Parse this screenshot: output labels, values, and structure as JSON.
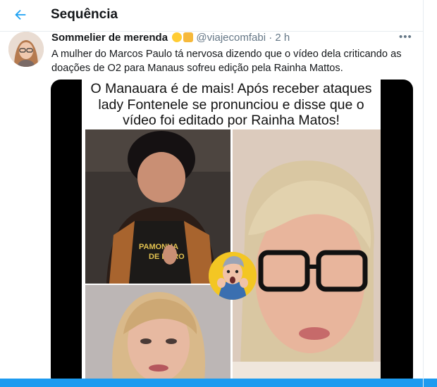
{
  "header": {
    "title": "Sequência",
    "back_icon": "arrow-left-icon"
  },
  "tweet": {
    "author_name": "Sommelier de merenda",
    "author_emojis": [
      "smiling-face-emoji",
      "food-box-emoji"
    ],
    "handle": "@viajecomfabi",
    "separator": "·",
    "time": "2 h",
    "more_label": "•••",
    "text": "A mulher do Marcos Paulo tá nervosa dizendo que o vídeo dela criticando as doações de O2 para Manaus sofreu edição pela Rainha Mattos."
  },
  "media": {
    "headline": "O Manauara é de mais! Após receber ataques lady Fontenele se pronunciou e disse que o vídeo foi editado por Rainha Matos!",
    "shirt_text_1": "PAMONHA",
    "shirt_text_2": "DE DURO"
  },
  "colors": {
    "accent": "#1da1f2",
    "text_primary": "#14171a",
    "text_secondary": "#657786",
    "border": "#e6ecf0",
    "sticker_bg": "#f3c623"
  }
}
